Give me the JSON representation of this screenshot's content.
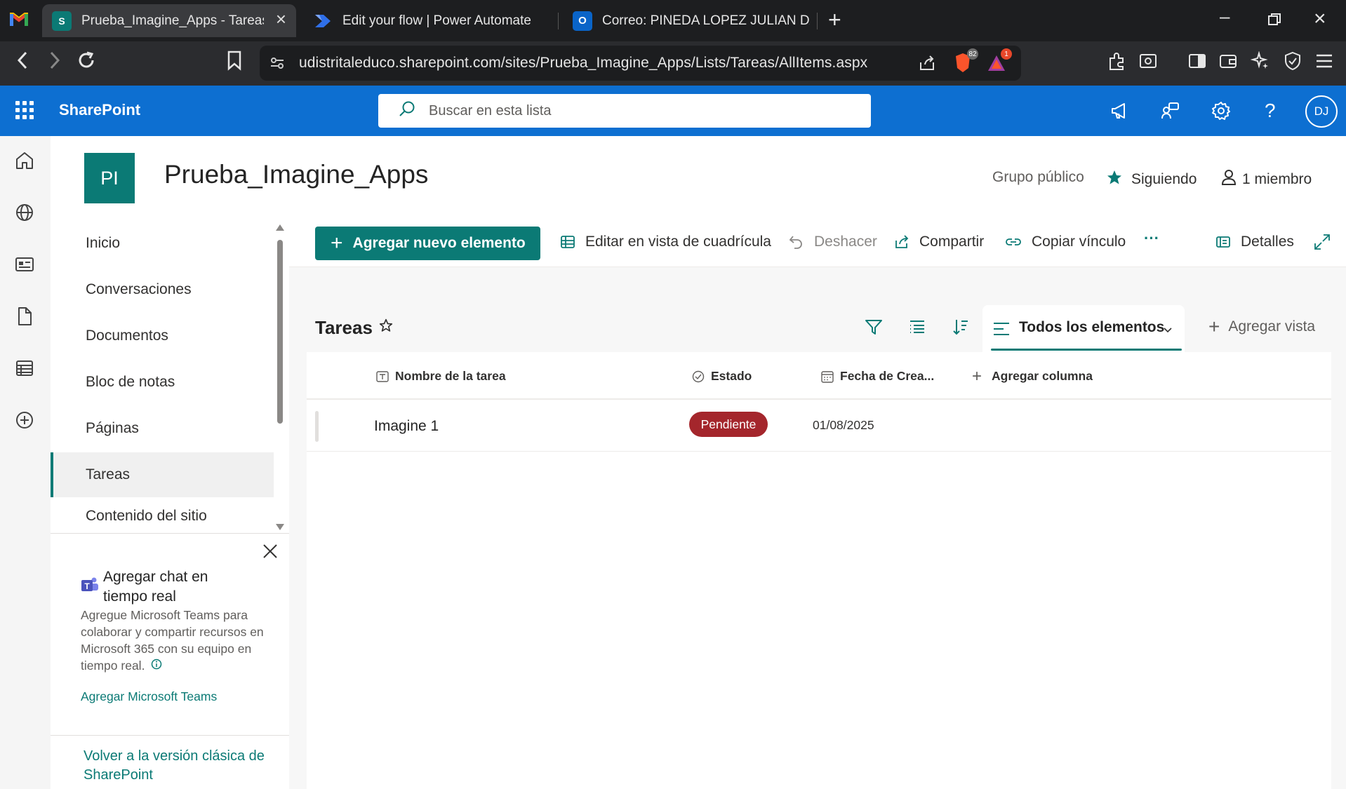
{
  "browser": {
    "tabs": [
      {
        "title": "Prueba_Imagine_Apps - Tareas -",
        "active": true,
        "icon": "sharepoint-icon"
      },
      {
        "title": "Edit your flow | Power Automate",
        "active": false,
        "icon": "power-automate-icon"
      },
      {
        "title": "Correo: PINEDA LOPEZ JULIAN DAVID",
        "active": false,
        "icon": "outlook-icon"
      }
    ],
    "new_tab": "+",
    "url": "udistritaleduco.sharepoint.com/sites/Prueba_Imagine_Apps/Lists/Tareas/AllItems.aspx",
    "brave_badge": "82",
    "alert_badge": "1"
  },
  "suite": {
    "brand": "SharePoint",
    "search_placeholder": "Buscar en esta lista",
    "avatar_initials": "DJ"
  },
  "site": {
    "logo_initials": "PI",
    "title": "Prueba_Imagine_Apps",
    "privacy": "Grupo público",
    "follow_label": "Siguiendo",
    "members_label": "1 miembro"
  },
  "nav": {
    "items": [
      {
        "label": "Inicio"
      },
      {
        "label": "Conversaciones"
      },
      {
        "label": "Documentos"
      },
      {
        "label": "Bloc de notas"
      },
      {
        "label": "Páginas"
      },
      {
        "label": "Tareas",
        "selected": true
      },
      {
        "label": "Contenido del sitio"
      }
    ]
  },
  "promo": {
    "title": "Agregar chat en tiempo real",
    "text": "Agregue Microsoft Teams para colaborar y compartir recursos en Microsoft 365 con su equipo en tiempo real.",
    "link": "Agregar Microsoft Teams"
  },
  "classic_link": "Volver a la versión clásica de SharePoint",
  "commands": {
    "new_item": "Agregar nuevo elemento",
    "grid_edit": "Editar en vista de cuadrícula",
    "undo": "Deshacer",
    "share": "Compartir",
    "copy_link": "Copiar vínculo",
    "more": "···",
    "details": "Detalles"
  },
  "list": {
    "title": "Tareas",
    "view_name": "Todos los elementos",
    "add_view": "Agregar vista",
    "columns": [
      "Nombre de la tarea",
      "Estado",
      "Fecha de Crea...",
      "Agregar columna"
    ],
    "rows": [
      {
        "name": "Imagine 1",
        "status": "Pendiente",
        "date": "01/08/2025"
      }
    ]
  },
  "colors": {
    "suite_blue": "#0d6fd1",
    "theme_teal": "#0b7a75",
    "status_pending": "#a4262c"
  }
}
